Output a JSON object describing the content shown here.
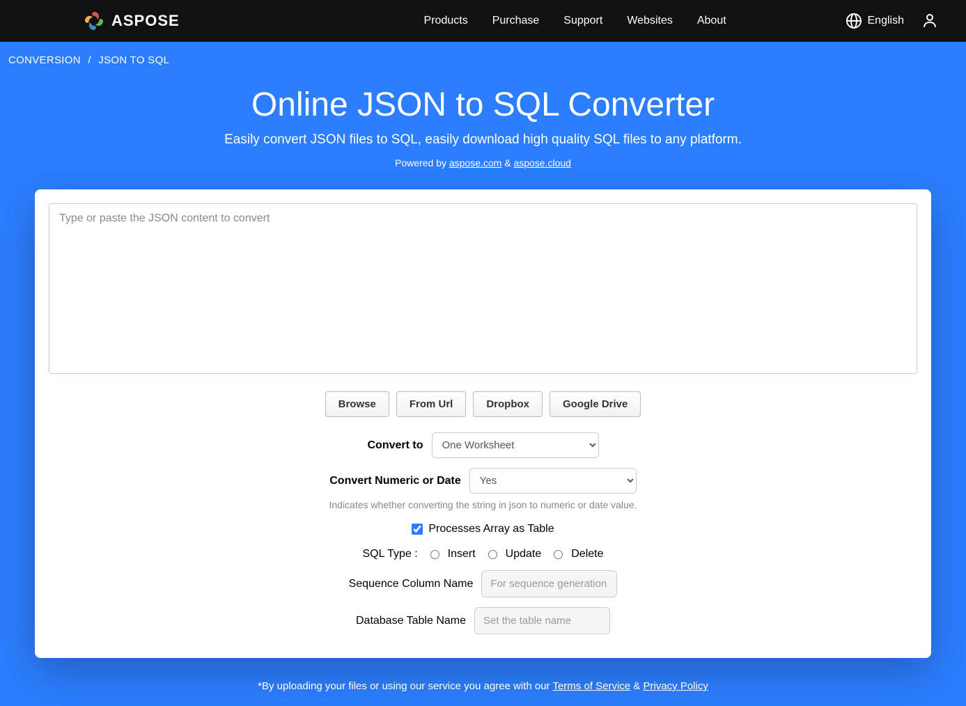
{
  "header": {
    "logo_text": "ASPOSE",
    "nav": [
      "Products",
      "Purchase",
      "Support",
      "Websites",
      "About"
    ],
    "language": "English"
  },
  "breadcrumb": {
    "items": [
      "CONVERSION",
      "JSON TO SQL"
    ]
  },
  "hero": {
    "title": "Online JSON to SQL Converter",
    "subtitle": "Easily convert JSON files to SQL, easily download high quality SQL files to any platform.",
    "powered_prefix": "Powered by ",
    "link1": "aspose.com",
    "amp": " & ",
    "link2": "aspose.cloud"
  },
  "form": {
    "json_placeholder": "Type or paste the JSON content to convert",
    "source_buttons": [
      "Browse",
      "From Url",
      "Dropbox",
      "Google Drive"
    ],
    "convert_to_label": "Convert to",
    "convert_to_value": "One Worksheet",
    "numeric_date_label": "Convert Numeric or Date",
    "numeric_date_value": "Yes",
    "numeric_date_hint": "Indicates whether converting the string in json to numeric or date value.",
    "array_table_label": "Processes Array as Table",
    "sql_type_label": "SQL Type :",
    "sql_type_options": [
      "Insert",
      "Update",
      "Delete"
    ],
    "sequence_label": "Sequence Column Name",
    "sequence_placeholder": "For sequence generation",
    "table_label": "Database Table Name",
    "table_placeholder": "Set the table name"
  },
  "notice": {
    "prefix": "*By uploading your files or using our service you agree with our ",
    "tos": "Terms of Service",
    "amp": " & ",
    "privacy": "Privacy Policy"
  }
}
